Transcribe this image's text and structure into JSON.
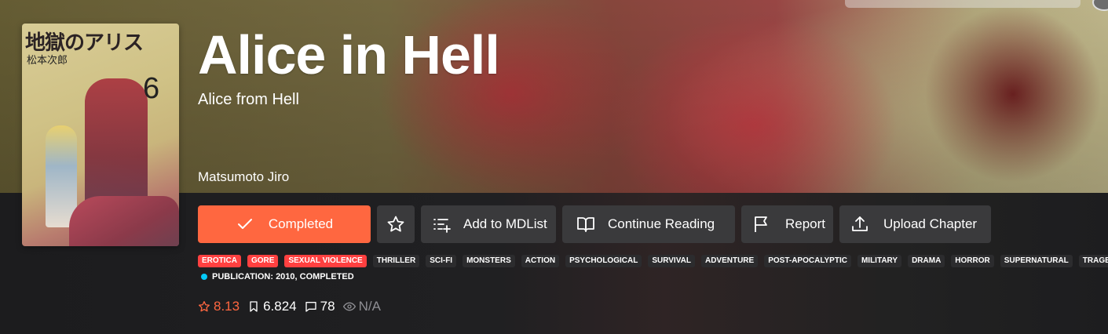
{
  "title": "Alice in Hell",
  "alt_title": "Alice from Hell",
  "author": "Matsumoto Jiro",
  "cover": {
    "title_text": "地獄のアリス",
    "author_text": "松本次郎",
    "volume": "6",
    "flag": "japan-flag"
  },
  "buttons": {
    "completed": "Completed",
    "add_mdlist": "Add to MDList",
    "continue": "Continue Reading",
    "report": "Report",
    "upload": "Upload Chapter"
  },
  "tags": [
    {
      "label": "Erotica",
      "highlight": true
    },
    {
      "label": "Gore",
      "highlight": true
    },
    {
      "label": "Sexual Violence",
      "highlight": true
    },
    {
      "label": "Thriller",
      "highlight": false
    },
    {
      "label": "Sci-Fi",
      "highlight": false
    },
    {
      "label": "Monsters",
      "highlight": false
    },
    {
      "label": "Action",
      "highlight": false
    },
    {
      "label": "Psychological",
      "highlight": false
    },
    {
      "label": "Survival",
      "highlight": false
    },
    {
      "label": "Adventure",
      "highlight": false
    },
    {
      "label": "Post-Apocalyptic",
      "highlight": false
    },
    {
      "label": "Military",
      "highlight": false
    },
    {
      "label": "Drama",
      "highlight": false
    },
    {
      "label": "Horror",
      "highlight": false
    },
    {
      "label": "Supernatural",
      "highlight": false
    },
    {
      "label": "Tragedy",
      "highlight": false
    }
  ],
  "publication": "Publication: 2010, Completed",
  "stats": {
    "rating": "8.13",
    "follows": "6.824",
    "comments": "78",
    "views": "N/A"
  },
  "colors": {
    "accent": "#ff6740",
    "tag_highlight": "#ff4040",
    "status_dot": "#04cbf9"
  }
}
